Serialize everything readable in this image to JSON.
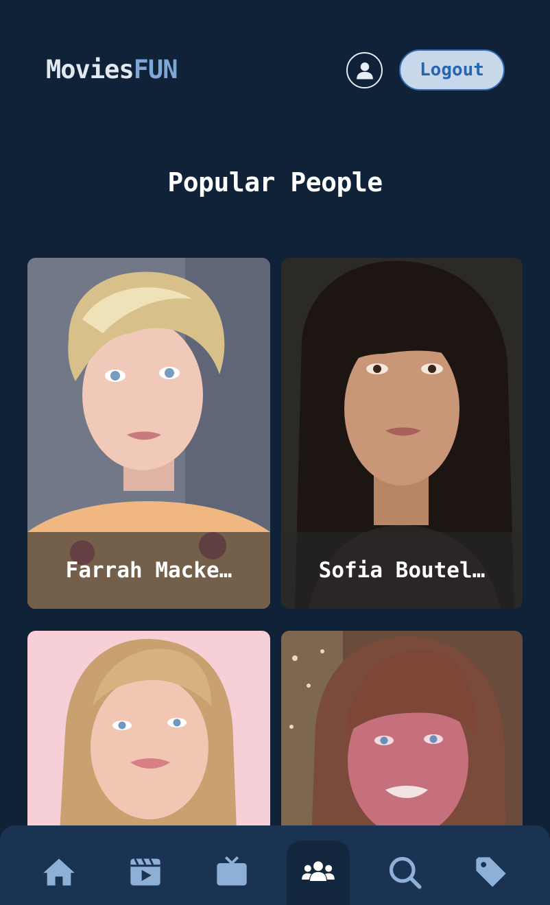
{
  "app": {
    "logo_part1": "Movies",
    "logo_part2": "FUN"
  },
  "header": {
    "profile_icon": "user-circle-icon",
    "logout_label": "Logout"
  },
  "page_title": "Popular People",
  "people": [
    {
      "name": "Farrah Macke…"
    },
    {
      "name": "Sofia Boutel…"
    },
    {
      "name": ""
    },
    {
      "name": ""
    }
  ],
  "bottom_nav": {
    "items": [
      {
        "icon": "home-icon",
        "active": false
      },
      {
        "icon": "movies-icon",
        "active": false
      },
      {
        "icon": "tv-icon",
        "active": false
      },
      {
        "icon": "people-icon",
        "active": true
      },
      {
        "icon": "search-icon",
        "active": false
      },
      {
        "icon": "tag-icon",
        "active": false
      }
    ]
  },
  "colors": {
    "background": "#0f2238",
    "accent": "#7ea6d6",
    "nav_background": "#1a3352",
    "nav_icon": "#8fb0d6"
  }
}
